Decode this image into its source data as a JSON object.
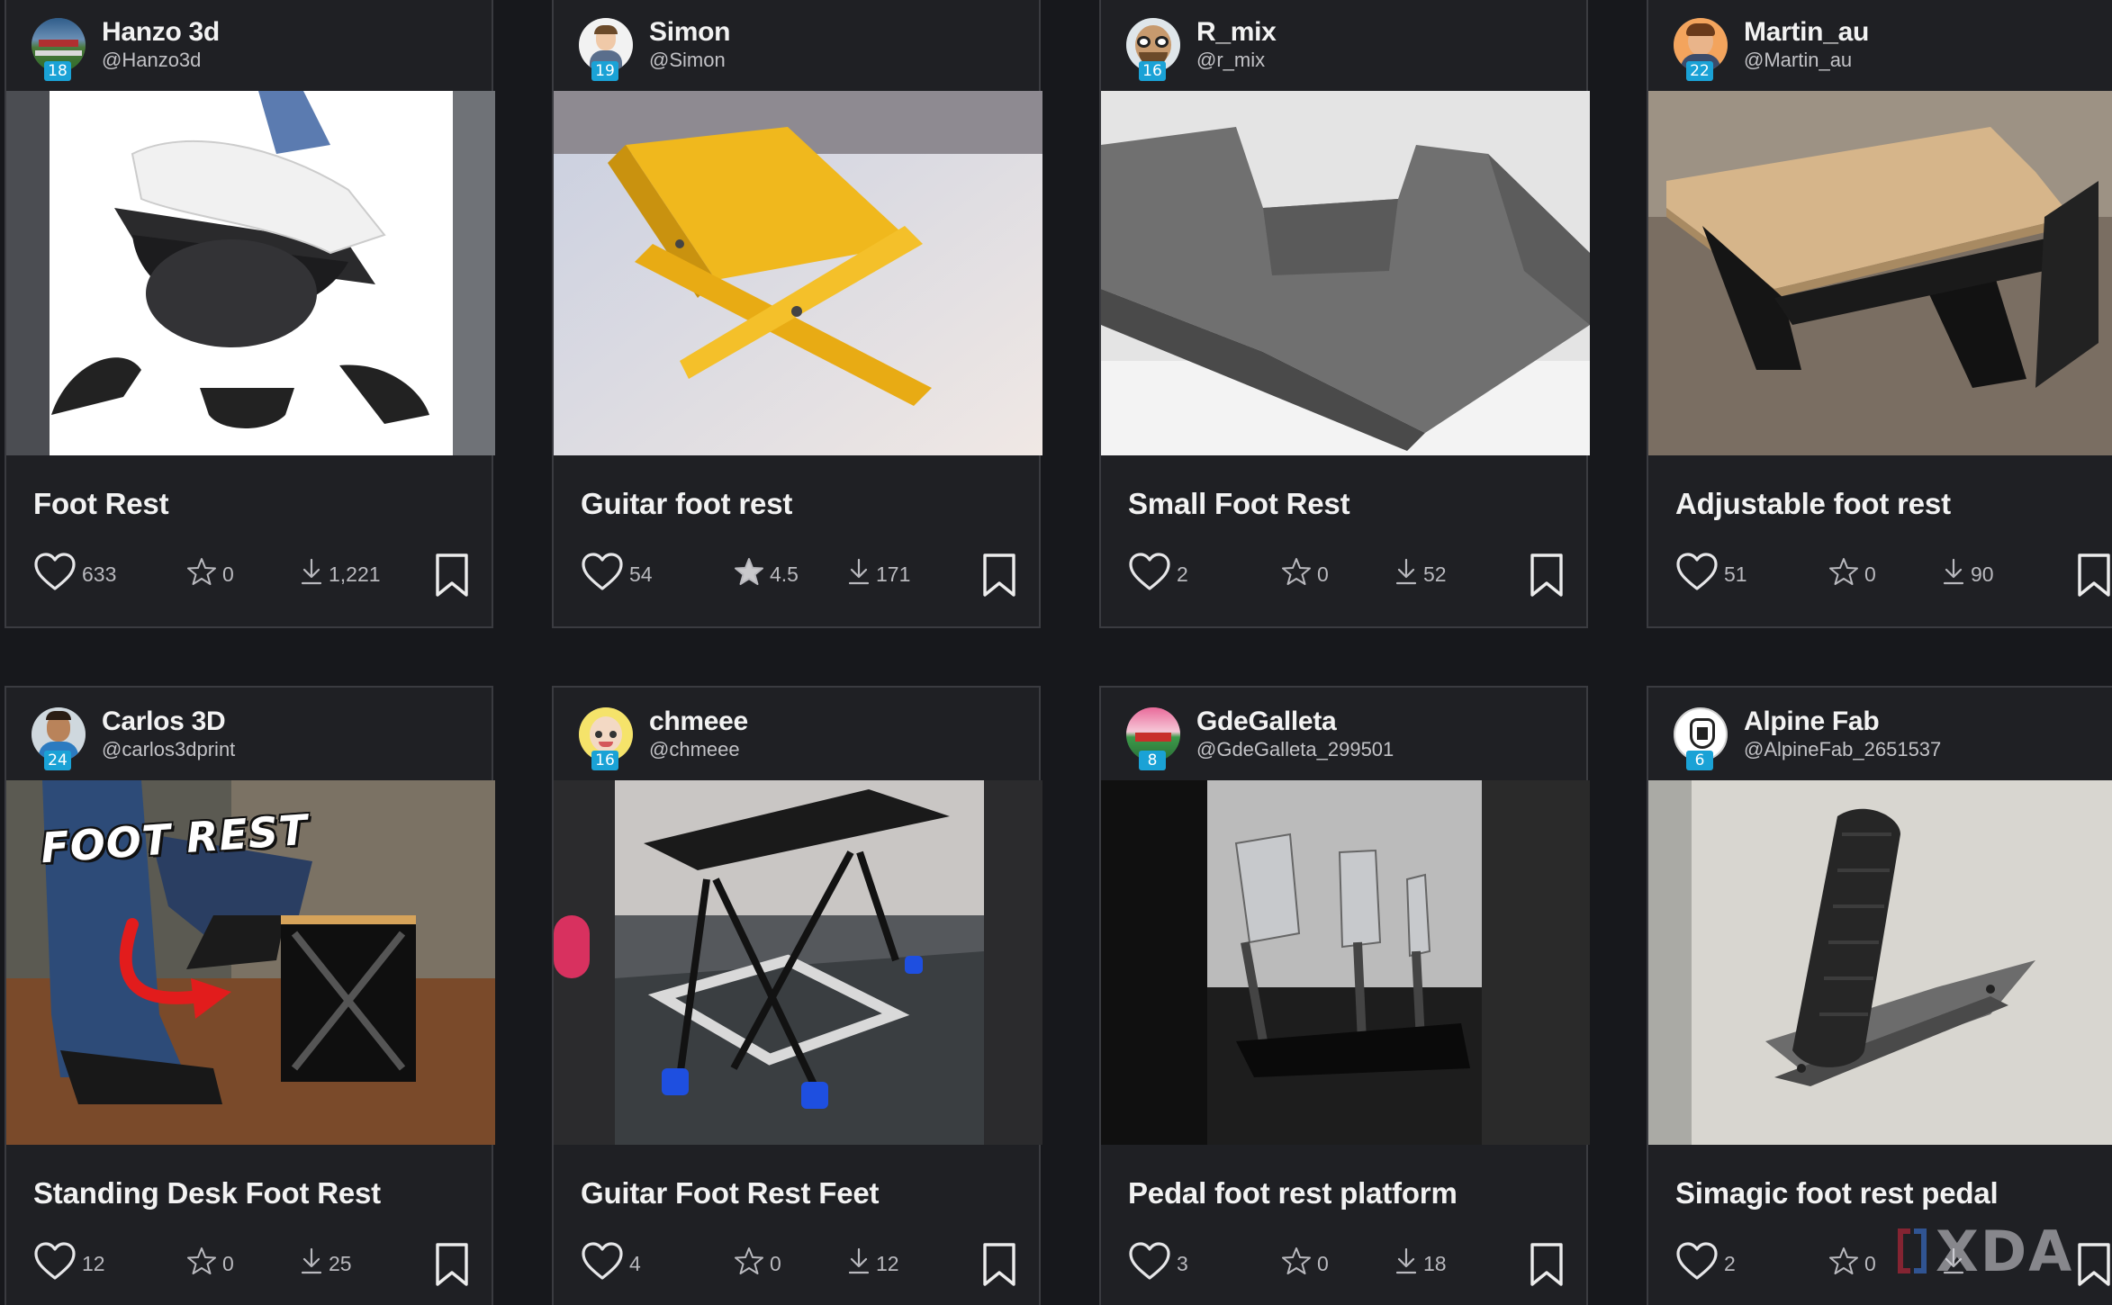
{
  "cards": [
    {
      "user": {
        "name": "Hanzo 3d",
        "handle": "@Hanzo3d",
        "level": "18"
      },
      "title": "Foot Rest",
      "likes": "633",
      "rating": "0",
      "rated": false,
      "downloads": "1,221",
      "image": "black-curved-foot-rest-with-sneakers"
    },
    {
      "user": {
        "name": "Simon",
        "handle": "@Simon",
        "level": "19"
      },
      "title": "Guitar foot rest",
      "likes": "54",
      "rating": "4.5",
      "rated": true,
      "downloads": "171",
      "image": "yellow-folding-guitar-foot-rest"
    },
    {
      "user": {
        "name": "R_mix",
        "handle": "@r_mix",
        "level": "16"
      },
      "title": "Small Foot Rest",
      "likes": "2",
      "rating": "0",
      "rated": false,
      "downloads": "52",
      "image": "grey-cradle-foot-rest-render"
    },
    {
      "user": {
        "name": "Martin_au",
        "handle": "@Martin_au",
        "level": "22"
      },
      "title": "Adjustable foot rest",
      "likes": "51",
      "rating": "0",
      "rated": false,
      "downloads": "90",
      "image": "wooden-top-foot-rest-on-black-legs"
    },
    {
      "user": {
        "name": "Carlos 3D",
        "handle": "@carlos3dprint",
        "level": "24"
      },
      "title": "Standing Desk Foot Rest",
      "likes": "12",
      "rating": "0",
      "rated": false,
      "downloads": "25",
      "image": "standing-desk-foot-rest-photo",
      "overlay": "FOOT REST"
    },
    {
      "user": {
        "name": "chmeee",
        "handle": "@chmeee",
        "level": "16"
      },
      "title": "Guitar Foot Rest Feet",
      "likes": "4",
      "rating": "0",
      "rated": false,
      "downloads": "12",
      "image": "folding-stool-with-blue-feet"
    },
    {
      "user": {
        "name": "GdeGalleta",
        "handle": "@GdeGalleta_299501",
        "level": "8"
      },
      "title": "Pedal foot rest platform",
      "likes": "3",
      "rating": "0",
      "rated": false,
      "downloads": "18",
      "image": "sim-racing-pedal-set"
    },
    {
      "user": {
        "name": "Alpine Fab",
        "handle": "@AlpineFab_2651537",
        "level": "6"
      },
      "title": "Simagic foot rest pedal",
      "likes": "2",
      "rating": "0",
      "rated": false,
      "downloads": "",
      "image": "carbon-fiber-foot-rest-pedal"
    }
  ],
  "watermark": "XDA",
  "colors": {
    "background": "#17181c",
    "card": "#1f2024",
    "border": "#3a3b40",
    "level_badge": "#1aa2d6",
    "text_muted": "#b9b9be"
  },
  "icons": {
    "likes": "heart-icon",
    "rating": "star-icon",
    "downloads": "download-icon",
    "save": "bookmark-icon"
  }
}
